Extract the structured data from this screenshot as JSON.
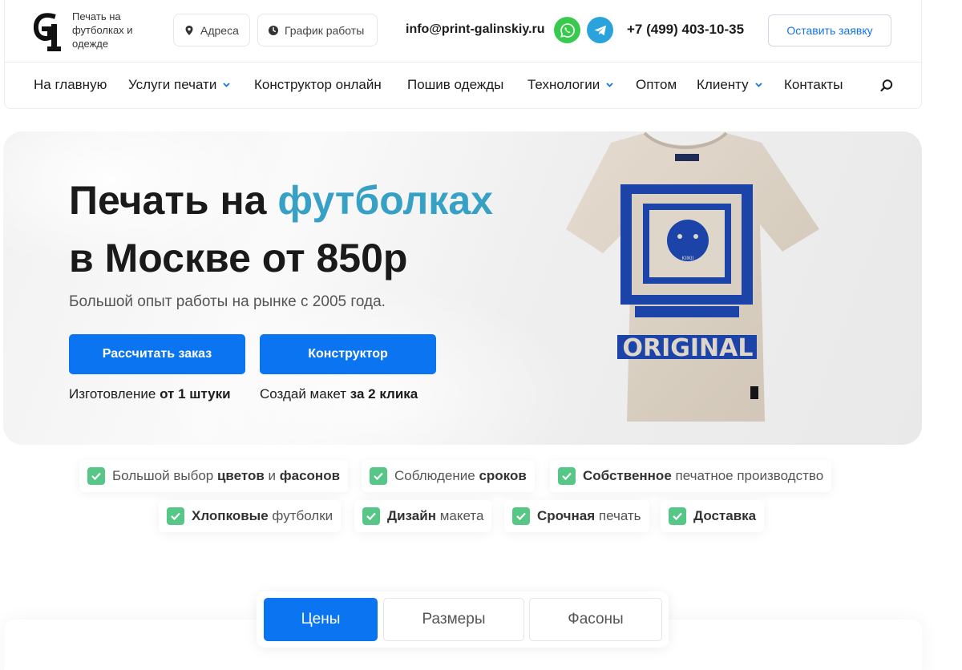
{
  "header": {
    "logo_text": "Печать на футболках и одежде",
    "address_label": "Адреса",
    "hours_label": "График работы",
    "email": "info@print-galinskiy.ru",
    "phone": "+7 (499) 403-10-35",
    "request_button": "Оставить заявку",
    "messengers": [
      "whatsapp-icon",
      "telegram-icon"
    ]
  },
  "nav": {
    "items": [
      {
        "label": "На главную",
        "dropdown": false
      },
      {
        "label": "Услуги печати",
        "dropdown": true
      },
      {
        "label": "Конструктор онлайн",
        "dropdown": false
      },
      {
        "label": "Пошив одежды",
        "dropdown": false
      },
      {
        "label": "Технологии",
        "dropdown": true
      },
      {
        "label": "Оптом",
        "dropdown": false
      },
      {
        "label": "Клиенту",
        "dropdown": true
      },
      {
        "label": "Контакты",
        "dropdown": false
      }
    ]
  },
  "hero": {
    "title_part1": "Печать на ",
    "title_accent": "футболках",
    "title_line2": "в Москве от 850р",
    "subtitle": "Большой опыт работы на рынке с 2005 года.",
    "calc_button": "Рассчитать заказ",
    "constructor_button": "Конструктор",
    "caption1_prefix": "Изготовление ",
    "caption1_bold": "от 1 штуки",
    "caption2_prefix": "Создай макет ",
    "caption2_bold": "за 2 клика",
    "shirt_print_text": "ORIGINAL",
    "shirt_label": "KIIKII"
  },
  "features": [
    {
      "parts": [
        [
          "Большой выбор ",
          false
        ],
        [
          "цветов",
          true
        ],
        [
          " и ",
          false
        ],
        [
          "фасонов",
          true
        ]
      ]
    },
    {
      "parts": [
        [
          "Соблюдение ",
          false
        ],
        [
          "сроков",
          true
        ]
      ]
    },
    {
      "parts": [
        [
          "Собственное",
          true
        ],
        [
          " печатное производство",
          false
        ]
      ]
    },
    {
      "parts": [
        [
          "Хлопковые",
          true
        ],
        [
          " футболки",
          false
        ]
      ]
    },
    {
      "parts": [
        [
          "Дизайн",
          true
        ],
        [
          " макета",
          false
        ]
      ]
    },
    {
      "parts": [
        [
          "Срочная",
          true
        ],
        [
          " печать",
          false
        ]
      ]
    },
    {
      "parts": [
        [
          "Доставка",
          true
        ]
      ]
    }
  ],
  "tabs": [
    {
      "label": "Цены",
      "active": true
    },
    {
      "label": "Размеры",
      "active": false
    },
    {
      "label": "Фасоны",
      "active": false
    }
  ],
  "colors": {
    "accent_blue": "#0b74f0",
    "title_accent": "#36a1c4",
    "check_green": "#56c787",
    "whatsapp": "#39c94e",
    "telegram": "#2aa3dd"
  }
}
